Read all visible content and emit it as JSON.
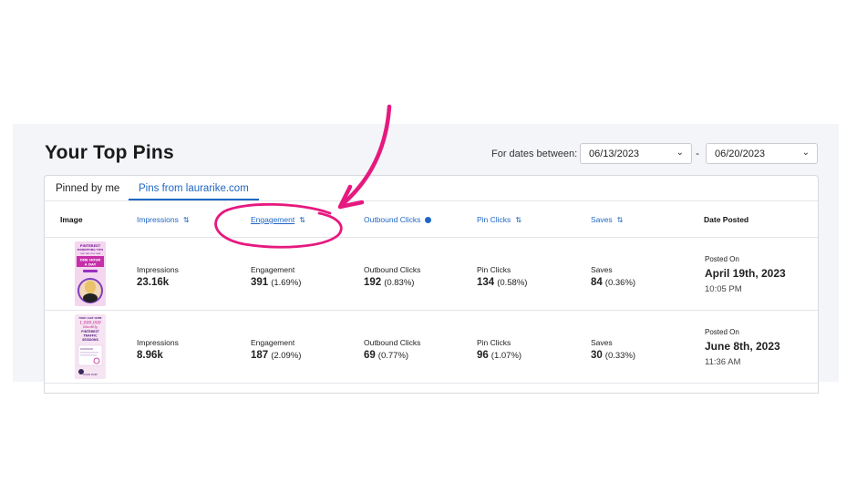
{
  "title": "Your Top Pins",
  "dates": {
    "label": "For dates between:",
    "start": "06/13/2023",
    "end": "06/20/2023",
    "separator": "-"
  },
  "tabs": [
    "Pinned by me",
    "Pins from laurarike.com"
  ],
  "columns": {
    "image": "Image",
    "impressions": "Impressions",
    "engagement": "Engagement",
    "outbound": "Outbound Clicks",
    "pin_clicks": "Pin Clicks",
    "saves": "Saves",
    "date_posted": "Date Posted"
  },
  "rows": [
    {
      "impressions_label": "Impressions",
      "impressions": "23.16k",
      "engagement_label": "Engagement",
      "engagement": "391",
      "engagement_pct": "(1.69%)",
      "outbound_label": "Outbound Clicks",
      "outbound": "192",
      "outbound_pct": "(0.83%)",
      "pin_clicks_label": "Pin Clicks",
      "pin_clicks": "134",
      "pin_clicks_pct": "(0.58%)",
      "saves_label": "Saves",
      "saves": "84",
      "saves_pct": "(0.36%)",
      "posted_label": "Posted On",
      "posted_date": "April 19th, 2023",
      "posted_time": "10:05 PM",
      "thumb_text": [
        "PINTEREST",
        "MARKETING TIPS",
        "THAT TAKE LESS THAN",
        "ONE HOUR",
        "A DAY"
      ]
    },
    {
      "impressions_label": "Impressions",
      "impressions": "8.96k",
      "engagement_label": "Engagement",
      "engagement": "187",
      "engagement_pct": "(2.09%)",
      "outbound_label": "Outbound Clicks",
      "outbound": "69",
      "outbound_pct": "(0.77%)",
      "pin_clicks_label": "Pin Clicks",
      "pin_clicks": "96",
      "pin_clicks_pct": "(1.07%)",
      "saves_label": "Saves",
      "saves": "30",
      "saves_pct": "(0.33%)",
      "posted_label": "Posted On",
      "posted_date": "June 8th, 2023",
      "posted_time": "11:36 AM",
      "thumb_text": [
        "HOW I GOT OVER",
        "1,000,000",
        "Monthly",
        "PINTEREST",
        "TRAFFIC",
        "SESSIONS",
        "LEARN MORE"
      ]
    }
  ],
  "colors": {
    "accent": "#1f66c4",
    "annotation": "#e6197f",
    "panel_bg": "#f3f5f8"
  },
  "icons": {
    "sort": "sort-arrows-icon",
    "info": "info-icon",
    "chevron": "chevron-down-icon"
  }
}
